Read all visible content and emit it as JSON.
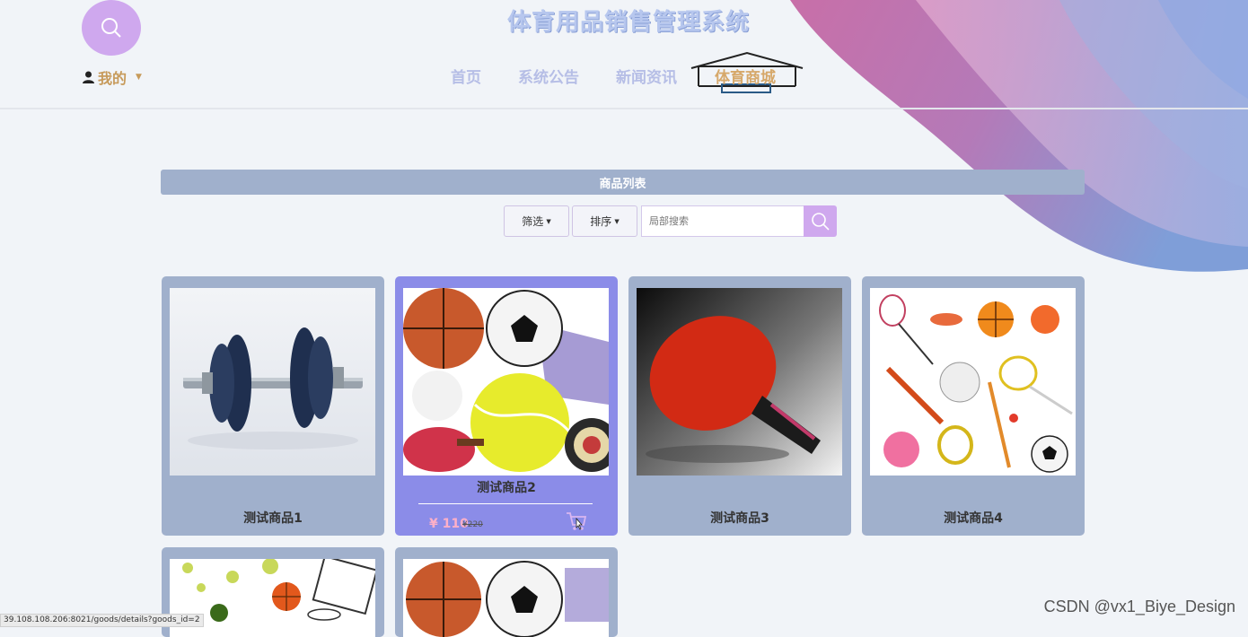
{
  "header": {
    "site_title": "体育用品销售管理系统",
    "mine_label": "我的",
    "nav": [
      {
        "label": "首页",
        "active": false
      },
      {
        "label": "系统公告",
        "active": false
      },
      {
        "label": "新闻资讯",
        "active": false
      },
      {
        "label": "体育商城",
        "active": true
      }
    ]
  },
  "panel": {
    "title": "商品列表",
    "filter_label": "筛选",
    "sort_label": "排序",
    "search_placeholder": "局部搜索"
  },
  "products": [
    {
      "name": "测试商品1"
    },
    {
      "name": "测试商品2",
      "price": "¥ 110",
      "old_price": "¥220"
    },
    {
      "name": "测试商品3"
    },
    {
      "name": "测试商品4"
    }
  ],
  "status_url": "39.108.108.206:8021/goods/details?goods_id=2",
  "watermark": "CSDN @vx1_Biye_Design",
  "colors": {
    "accent": "#cfa8ee",
    "panel": "#a0b0cc",
    "card_hover": "#8b8ce8",
    "nav_active": "#d6a86a",
    "nav": "#b6bee6"
  },
  "icons": [
    "search-icon",
    "user-icon",
    "caret-down-icon",
    "cart-icon"
  ]
}
